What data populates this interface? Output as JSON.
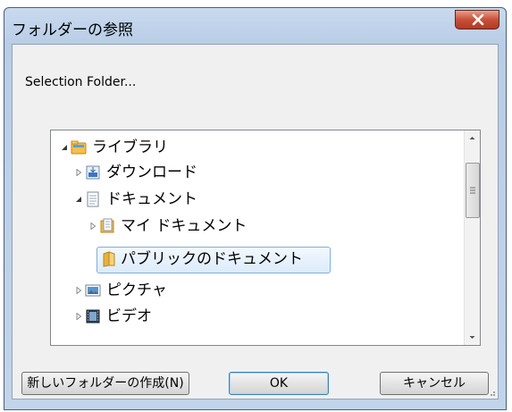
{
  "window": {
    "title": "フォルダーの参照",
    "close_icon": "close-icon",
    "accent": "#c85038"
  },
  "dialog": {
    "description": "Selection Folder..."
  },
  "tree": {
    "items": [
      {
        "label": "ライブラリ",
        "icon": "library-folder-icon",
        "state": "expanded",
        "level": 0
      },
      {
        "label": "ダウンロード",
        "icon": "download-folder-icon",
        "state": "collapsed",
        "level": 1
      },
      {
        "label": "ドキュメント",
        "icon": "documents-library-icon",
        "state": "expanded",
        "level": 1
      },
      {
        "label": "マイ ドキュメント",
        "icon": "my-documents-icon",
        "state": "collapsed",
        "level": 2
      },
      {
        "label": "パブリックのドキュメント",
        "icon": "folder-icon",
        "state": "selected",
        "level": 2
      },
      {
        "label": "ピクチャ",
        "icon": "pictures-library-icon",
        "state": "collapsed",
        "level": 1
      },
      {
        "label": "ビデオ",
        "icon": "videos-library-icon",
        "state": "collapsed",
        "level": 1
      }
    ],
    "selection_color": "#dcebfc"
  },
  "buttons": {
    "new_folder": "新しいフォルダーの作成(N)",
    "ok": "OK",
    "cancel": "キャンセル"
  }
}
